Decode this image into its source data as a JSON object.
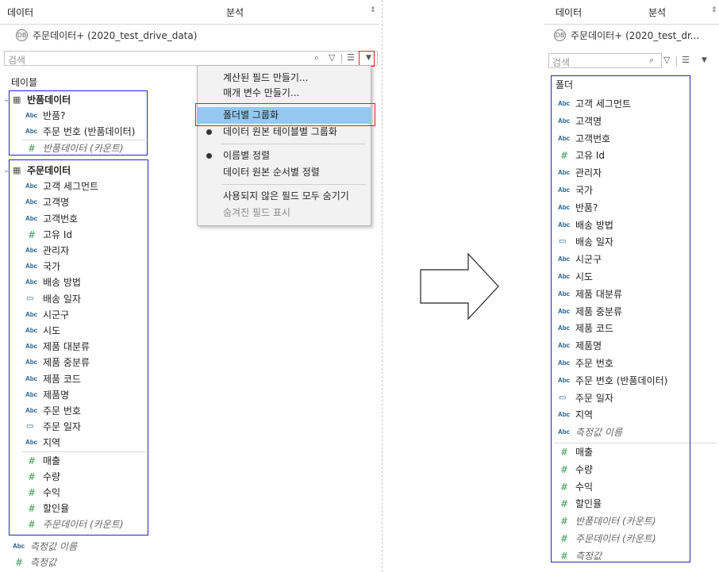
{
  "left": {
    "tabs": [
      {
        "label": "데이터"
      },
      {
        "label": "분석"
      }
    ],
    "datasource": "주문데이터+ (2020_test_drive_data)",
    "search_placeholder": "검색",
    "section_label": "테이블",
    "tables": [
      {
        "name": "반품데이터",
        "fields": [
          {
            "type": "abc",
            "label": "반품?"
          },
          {
            "type": "abc",
            "label": "주문 번호 (반품데이터)"
          },
          {
            "type": "num",
            "label": "반품데이터 (카운트)",
            "italic": true
          }
        ]
      },
      {
        "name": "주문데이터",
        "fields": [
          {
            "type": "abc",
            "label": "고객 세그먼트"
          },
          {
            "type": "abc",
            "label": "고객명"
          },
          {
            "type": "abc",
            "label": "고객번호"
          },
          {
            "type": "num",
            "label": "고유 Id"
          },
          {
            "type": "abc",
            "label": "관리자"
          },
          {
            "type": "abc",
            "label": "국가"
          },
          {
            "type": "abc",
            "label": "배송 방법"
          },
          {
            "type": "date",
            "label": "배송 일자"
          },
          {
            "type": "abc",
            "label": "시군구"
          },
          {
            "type": "abc",
            "label": "시도"
          },
          {
            "type": "abc",
            "label": "제품 대분류"
          },
          {
            "type": "abc",
            "label": "제품 중분류"
          },
          {
            "type": "abc",
            "label": "제품 코드"
          },
          {
            "type": "abc",
            "label": "제품명"
          },
          {
            "type": "abc",
            "label": "주문 번호"
          },
          {
            "type": "date",
            "label": "주문 일자"
          },
          {
            "type": "abc",
            "label": "지역"
          }
        ],
        "measures": [
          {
            "type": "num",
            "label": "매출"
          },
          {
            "type": "num",
            "label": "수량"
          },
          {
            "type": "num",
            "label": "수익"
          },
          {
            "type": "num",
            "label": "할인율"
          },
          {
            "type": "num",
            "label": "주문데이터 (카운트)",
            "italic": true
          }
        ]
      }
    ],
    "extra": [
      {
        "type": "abc",
        "label": "측정값 이름",
        "italic": true
      },
      {
        "type": "num",
        "label": "측정값",
        "italic": true
      }
    ]
  },
  "menu": {
    "items": [
      {
        "label": "계산된 필드 만들기..."
      },
      {
        "label": "매개 변수 만들기..."
      },
      {
        "label": "폴더별 그룹화"
      },
      {
        "label": "데이터 원본 테이블별 그룹화"
      },
      {
        "label": "이름별 정렬"
      },
      {
        "label": "데이터 원본 순서별 정렬"
      },
      {
        "label": "사용되지 않은 필드 모두 숨기기"
      },
      {
        "label": "숨겨진 필드 표시"
      }
    ]
  },
  "right": {
    "tabs": [
      {
        "label": "데이터"
      },
      {
        "label": "분석"
      }
    ],
    "datasource": "주문데이터+ (2020_test_dr...",
    "search_placeholder": "검색",
    "section_label": "폴더",
    "dimensions": [
      {
        "type": "abc",
        "label": "고객 세그먼트"
      },
      {
        "type": "abc",
        "label": "고객명"
      },
      {
        "type": "abc",
        "label": "고객번호"
      },
      {
        "type": "num",
        "label": "고유 Id"
      },
      {
        "type": "abc",
        "label": "관리자"
      },
      {
        "type": "abc",
        "label": "국가"
      },
      {
        "type": "abc",
        "label": "반품?"
      },
      {
        "type": "abc",
        "label": "배송 방법"
      },
      {
        "type": "date",
        "label": "배송 일자"
      },
      {
        "type": "abc",
        "label": "시군구"
      },
      {
        "type": "abc",
        "label": "시도"
      },
      {
        "type": "abc",
        "label": "제품 대분류"
      },
      {
        "type": "abc",
        "label": "제품 중분류"
      },
      {
        "type": "abc",
        "label": "제품 코드"
      },
      {
        "type": "abc",
        "label": "제품명"
      },
      {
        "type": "abc",
        "label": "주문 번호"
      },
      {
        "type": "abc",
        "label": "주문 번호 (반품데이터)"
      },
      {
        "type": "date",
        "label": "주문 일자"
      },
      {
        "type": "abc",
        "label": "지역"
      },
      {
        "type": "abc",
        "label": "측정값 이름",
        "italic": true
      }
    ],
    "measures": [
      {
        "type": "num",
        "label": "매출"
      },
      {
        "type": "num",
        "label": "수량"
      },
      {
        "type": "num",
        "label": "수익"
      },
      {
        "type": "num",
        "label": "할인율"
      },
      {
        "type": "num",
        "label": "반품데이터 (카운트)",
        "italic": true
      },
      {
        "type": "num",
        "label": "주문데이터 (카운트)",
        "italic": true
      },
      {
        "type": "num",
        "label": "측정값",
        "italic": true
      }
    ]
  },
  "icons": {
    "abc": "abc-type-icon",
    "num": "number-type-icon",
    "date": "date-type-icon",
    "table": "table-icon",
    "sort": "tab-sort-icon",
    "search": "search-icon",
    "filter": "filter-icon",
    "view": "view-options-icon",
    "dropdown": "dropdown-arrow-icon",
    "datasource": "datasource-icon"
  },
  "colors": {
    "highlight": "#93c9f1",
    "annotation_blue": "#2222cc",
    "annotation_red": "#e02020",
    "measure_green": "#3c9a55",
    "dimension_blue": "#1f5c8a"
  }
}
